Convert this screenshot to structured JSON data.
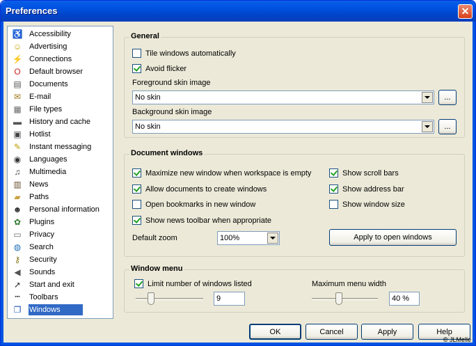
{
  "window": {
    "title": "Preferences",
    "close_glyph": "✕"
  },
  "sidebar": {
    "items": [
      {
        "label": "Accessibility",
        "icon": "accessibility-icon",
        "glyph": "♿",
        "color": "#1f4fb5"
      },
      {
        "label": "Advertising",
        "icon": "smiley-icon",
        "glyph": "☺",
        "color": "#c8a000"
      },
      {
        "label": "Connections",
        "icon": "plug-icon",
        "glyph": "⚡",
        "color": "#a03030"
      },
      {
        "label": "Default browser",
        "icon": "default-browser-icon",
        "glyph": "O",
        "color": "#cc2020"
      },
      {
        "label": "Documents",
        "icon": "documents-icon",
        "glyph": "▤",
        "color": "#555555"
      },
      {
        "label": "E-mail",
        "icon": "envelope-icon",
        "glyph": "✉",
        "color": "#a07a20"
      },
      {
        "label": "File types",
        "icon": "file-types-icon",
        "glyph": "▦",
        "color": "#6a6a6a"
      },
      {
        "label": "History and cache",
        "icon": "history-icon",
        "glyph": "▬",
        "color": "#555555"
      },
      {
        "label": "Hotlist",
        "icon": "hotlist-icon",
        "glyph": "▣",
        "color": "#444444"
      },
      {
        "label": "Instant messaging",
        "icon": "messaging-icon",
        "glyph": "✎",
        "color": "#c0a000"
      },
      {
        "label": "Languages",
        "icon": "languages-icon",
        "glyph": "◉",
        "color": "#333333"
      },
      {
        "label": "Multimedia",
        "icon": "multimedia-icon",
        "glyph": "♫",
        "color": "#444444"
      },
      {
        "label": "News",
        "icon": "news-icon",
        "glyph": "▥",
        "color": "#6a5030"
      },
      {
        "label": "Paths",
        "icon": "folder-icon",
        "glyph": "▰",
        "color": "#c8a040"
      },
      {
        "label": "Personal information",
        "icon": "person-icon",
        "glyph": "☻",
        "color": "#333333"
      },
      {
        "label": "Plugins",
        "icon": "plugins-icon",
        "glyph": "✿",
        "color": "#2f7a2f"
      },
      {
        "label": "Privacy",
        "icon": "privacy-icon",
        "glyph": "▭",
        "color": "#6a6a6a"
      },
      {
        "label": "Search",
        "icon": "globe-icon",
        "glyph": "◍",
        "color": "#1f6fb5"
      },
      {
        "label": "Security",
        "icon": "key-icon",
        "glyph": "⚷",
        "color": "#8a7a20"
      },
      {
        "label": "Sounds",
        "icon": "speaker-icon",
        "glyph": "◀",
        "color": "#555555"
      },
      {
        "label": "Start and exit",
        "icon": "start-exit-icon",
        "glyph": "➚",
        "color": "#333333"
      },
      {
        "label": "Toolbars",
        "icon": "toolbars-icon",
        "glyph": "▪▪▪",
        "color": "#333333"
      },
      {
        "label": "Windows",
        "icon": "windows-icon",
        "glyph": "❐",
        "color": "#1f4fb5",
        "selected": true
      }
    ]
  },
  "general": {
    "title": "General",
    "tile_windows": {
      "label": "Tile windows automatically",
      "checked": false
    },
    "avoid_flicker": {
      "label": "Avoid flicker",
      "checked": true
    },
    "foreground_label": "Foreground skin image",
    "foreground_value": "No skin",
    "background_label": "Background skin image",
    "background_value": "No skin",
    "browse_label": "..."
  },
  "document_windows": {
    "title": "Document windows",
    "maximize": {
      "label": "Maximize new window when workspace is empty",
      "checked": true
    },
    "allow_docs": {
      "label": "Allow documents to create windows",
      "checked": true
    },
    "open_bookmarks": {
      "label": "Open bookmarks in new window",
      "checked": false
    },
    "show_news": {
      "label": "Show news toolbar when appropriate",
      "checked": true
    },
    "show_scroll": {
      "label": "Show scroll bars",
      "checked": true
    },
    "show_address": {
      "label": "Show address bar",
      "checked": true
    },
    "show_size": {
      "label": "Show window size",
      "checked": false
    },
    "default_zoom_label": "Default zoom",
    "default_zoom_value": "100%",
    "apply_open_label": "Apply to open windows"
  },
  "window_menu": {
    "title": "Window menu",
    "limit": {
      "label": "Limit number of windows listed",
      "checked": true
    },
    "limit_value": "9",
    "limit_slider_fraction": 0.2,
    "max_width_label": "Maximum menu width",
    "max_width_value": "40 %",
    "max_width_slider_fraction": 0.4
  },
  "buttons": {
    "ok": "OK",
    "cancel": "Cancel",
    "apply": "Apply",
    "help": "Help"
  },
  "copyright": "© JLMelle"
}
